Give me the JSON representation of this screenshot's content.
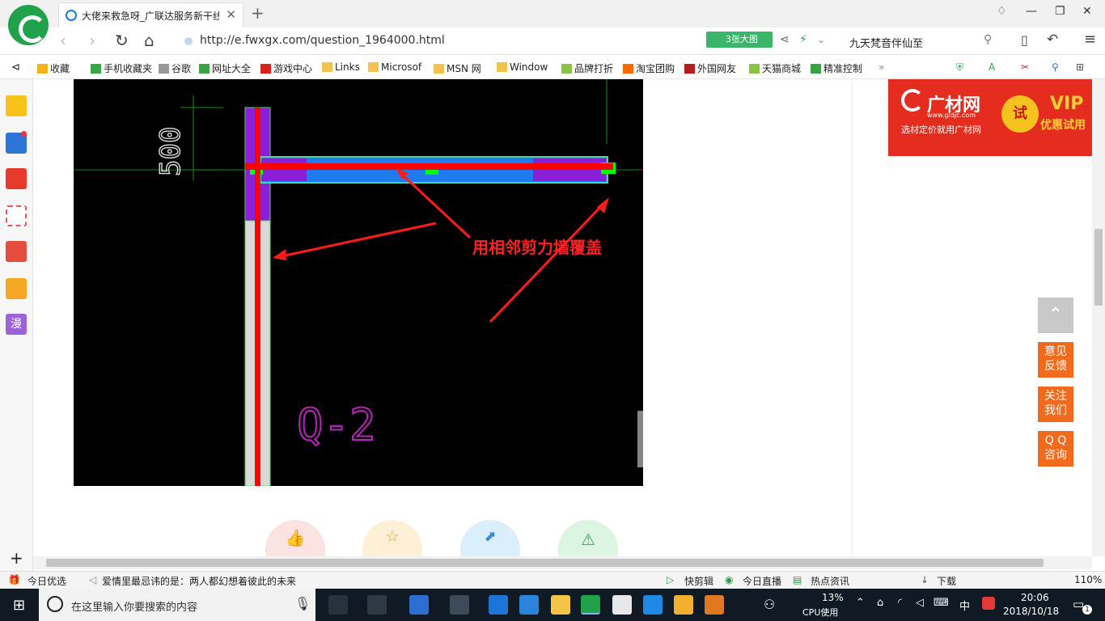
{
  "tab": {
    "title": "大佬来救急呀_广联达服务新干线"
  },
  "address": {
    "url": "http://e.fwxgx.com/question_1964000.html",
    "big_image": "3张大图"
  },
  "search": {
    "query": "九天梵音伴仙至"
  },
  "bookmarks": [
    {
      "label": "收藏",
      "color": "#f3b21b"
    },
    {
      "label": "手机收藏夹",
      "color": "#38a745"
    },
    {
      "label": "谷歌",
      "color": "#999999"
    },
    {
      "label": "网址大全",
      "color": "#3aa348"
    },
    {
      "label": "游戏中心",
      "color": "#d7241f"
    },
    {
      "label": "Links",
      "color": "#f1c34e"
    },
    {
      "label": "Microsof",
      "color": "#f1c34e"
    },
    {
      "label": "MSN 网",
      "color": "#f1c34e"
    },
    {
      "label": "Window",
      "color": "#f1c34e"
    },
    {
      "label": "品牌打折",
      "color": "#8bc34a"
    },
    {
      "label": "淘宝团购",
      "color": "#ff6a00"
    },
    {
      "label": "外国网友",
      "color": "#b71c1c"
    },
    {
      "label": "天猫商城",
      "color": "#8bc34a"
    },
    {
      "label": "精准控制",
      "color": "#3aa348"
    }
  ],
  "drawing": {
    "annotation": "用相邻剪力墙覆盖",
    "dimension": "500",
    "wall_label": "Q-2"
  },
  "ad": {
    "brand": "广材网",
    "site": "www.gldjc.com",
    "slogan": "选材定价就用广材网",
    "badge": "试",
    "vip": "VIP",
    "vip_sub": "优惠试用"
  },
  "float_buttons": {
    "feedback": "意见\n反馈",
    "follow": "关注\n我们",
    "qq": "Q Q\n咨询"
  },
  "status": {
    "today": "今日优选",
    "news": "爱情里最忌讳的是：两人都幻想着彼此的未来",
    "clip": "快剪辑",
    "live": "今日直播",
    "hot": "热点资讯",
    "download": "下载",
    "zoom": "110%"
  },
  "taskbar": {
    "search_placeholder": "在这里输入你要搜索的内容",
    "cpu": "13%",
    "cpu_label": "CPU使用",
    "ime": "中",
    "time": "20:06",
    "date": "2018/10/18",
    "notif": "1"
  }
}
